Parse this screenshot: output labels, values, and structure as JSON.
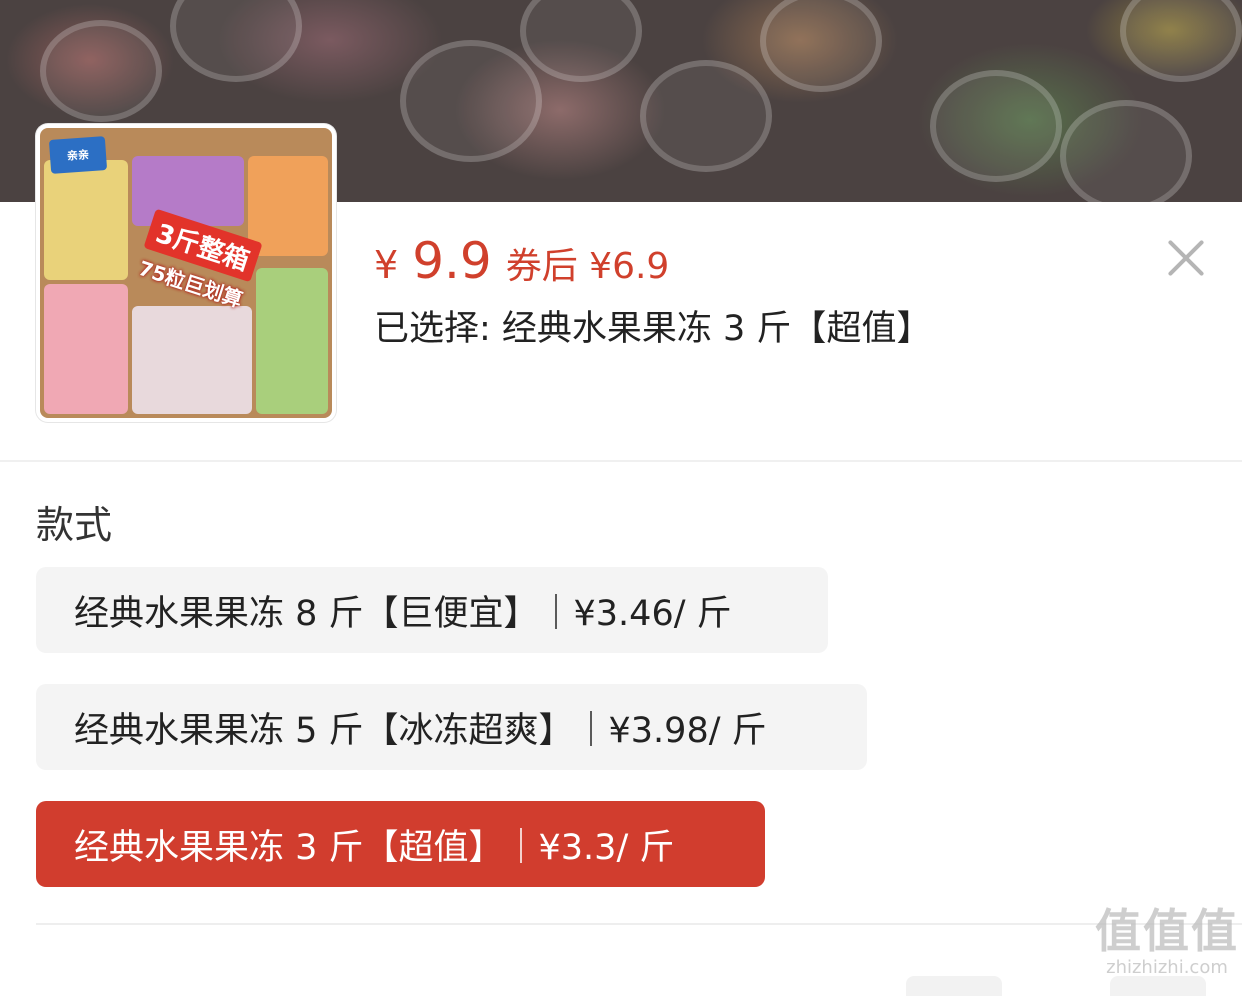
{
  "header": {
    "price_symbol": "¥",
    "price_value": "9.9",
    "coupon_text": "券后 ¥6.9",
    "selected_text": "已选择: 经典水果果冻 3 斤【超值】"
  },
  "thumbnail": {
    "logo_text": "亲亲",
    "badge_line1": "3斤整箱",
    "badge_line2": "75粒巨划算"
  },
  "options_section": {
    "title": "款式",
    "items": [
      {
        "label": "经典水果果冻 8 斤【巨便宜】｜¥3.46/ 斤",
        "selected": false
      },
      {
        "label": "经典水果果冻 5 斤【冰冻超爽】｜¥3.98/ 斤",
        "selected": false
      },
      {
        "label": "经典水果果冻 3 斤【超值】｜¥3.3/ 斤",
        "selected": true
      }
    ]
  },
  "watermark": {
    "big": "值值值",
    "small": "zhizhizhi.com"
  },
  "colors": {
    "accent": "#d13d2e",
    "price": "#d0402c",
    "option_bg": "#f4f4f4",
    "backdrop": "#4b4241"
  },
  "icons": {
    "close": "close-icon"
  }
}
